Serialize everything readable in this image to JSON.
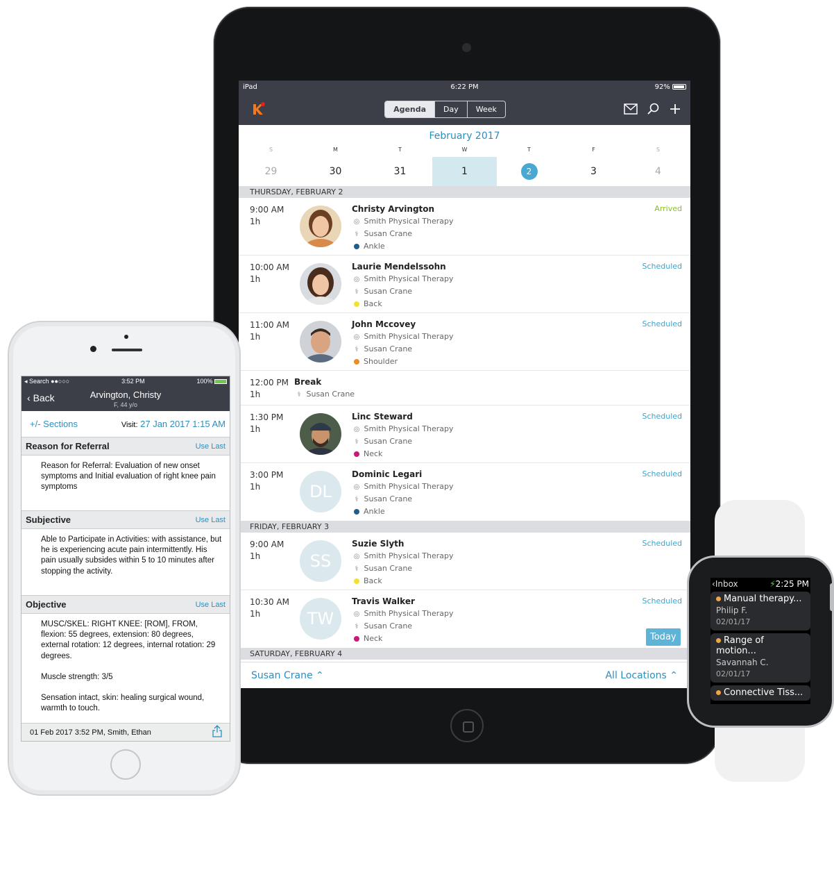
{
  "ipad": {
    "status": {
      "device": "iPad",
      "time": "6:22 PM",
      "battery": "92%"
    },
    "tabs": [
      "Agenda",
      "Day",
      "Week"
    ],
    "month": "February 2017",
    "dow": [
      "S",
      "M",
      "T",
      "W",
      "T",
      "F",
      "S"
    ],
    "dates": [
      "29",
      "30",
      "31",
      "1",
      "2",
      "3",
      "4"
    ],
    "days": [
      {
        "label": "THURSDAY, FEBRUARY 2",
        "items": [
          {
            "time": "9:00 AM",
            "dur": "1h",
            "name": "Christy Arvington",
            "loc": "Smith Physical Therapy",
            "prov": "Susan Crane",
            "tag": "Ankle",
            "tag_color": "#1f5e8a",
            "status": "Arrived"
          },
          {
            "time": "10:00 AM",
            "dur": "1h",
            "name": "Laurie Mendelssohn",
            "loc": "Smith Physical Therapy",
            "prov": "Susan Crane",
            "tag": "Back",
            "tag_color": "#f2e230",
            "status": "Scheduled"
          },
          {
            "time": "11:00 AM",
            "dur": "1h",
            "name": "John Mccovey",
            "loc": "Smith Physical Therapy",
            "prov": "Susan Crane",
            "tag": "Shoulder",
            "tag_color": "#f08a24",
            "status": "Scheduled"
          },
          {
            "time": "12:00 PM",
            "dur": "1h",
            "name": "Break",
            "prov": "Susan Crane"
          },
          {
            "time": "1:30 PM",
            "dur": "1h",
            "name": "Linc Steward",
            "loc": "Smith Physical Therapy",
            "prov": "Susan Crane",
            "tag": "Neck",
            "tag_color": "#c8197a",
            "status": "Scheduled"
          },
          {
            "time": "3:00 PM",
            "dur": "1h",
            "name": "Dominic Legari",
            "initials": "DL",
            "loc": "Smith Physical Therapy",
            "prov": "Susan Crane",
            "tag": "Ankle",
            "tag_color": "#1f5e8a",
            "status": "Scheduled"
          }
        ]
      },
      {
        "label": "FRIDAY, FEBRUARY 3",
        "items": [
          {
            "time": "9:00 AM",
            "dur": "1h",
            "name": "Suzie Slyth",
            "initials": "SS",
            "loc": "Smith Physical Therapy",
            "prov": "Susan Crane",
            "tag": "Back",
            "tag_color": "#f2e230",
            "status": "Scheduled"
          },
          {
            "time": "10:30 AM",
            "dur": "1h",
            "name": "Travis Walker",
            "initials": "TW",
            "loc": "Smith Physical Therapy",
            "prov": "Susan Crane",
            "tag": "Neck",
            "tag_color": "#c8197a",
            "status": "Scheduled"
          }
        ]
      }
    ],
    "next_day": "SATURDAY, FEBRUARY 4",
    "today_button": "Today",
    "provider_filter": "Susan Crane",
    "location_filter": "All Locations"
  },
  "iphone": {
    "status": {
      "carrier": "Search",
      "time": "3:52 PM",
      "battery": "100%"
    },
    "back": "Back",
    "patient": "Arvington, Christy",
    "patient_sub": "F, 44 y/o",
    "sections_link": "+/- Sections",
    "visit_label": "Visit:",
    "visit_value": "27 Jan 2017 1:15 AM",
    "use_last": "Use Last",
    "sections": [
      {
        "title": "Reason for Referral",
        "body": [
          "Reason for Referral: Evaluation of new onset symptoms and Initial evaluation of right knee pain symptoms"
        ]
      },
      {
        "title": "Subjective",
        "body": [
          "Able to Participate in Activities: with assistance, but he is experiencing acute pain intermittently. His pain usually subsides within 5 to 10 minutes after stopping the activity."
        ]
      },
      {
        "title": "Objective",
        "body": [
          "MUSC/SKEL: RIGHT KNEE: [ROM], FROM, flexion: 55 degrees, extension: 80 degrees, external rotation: 12 degrees, internal rotation: 29 degrees.",
          "Muscle strength:  3/5",
          "Sensation intact, skin: healing surgical wound, warmth to touch."
        ]
      }
    ],
    "footer": "01 Feb 2017 3:52 PM, Smith, Ethan"
  },
  "watch": {
    "back": "Inbox",
    "time": "2:25 PM",
    "items": [
      {
        "title": "Manual therapy...",
        "name": "Philip F.",
        "date": "02/01/17"
      },
      {
        "title": "Range of motion...",
        "name": "Savannah C.",
        "date": "02/01/17"
      },
      {
        "title": "Connective Tiss..."
      }
    ]
  }
}
